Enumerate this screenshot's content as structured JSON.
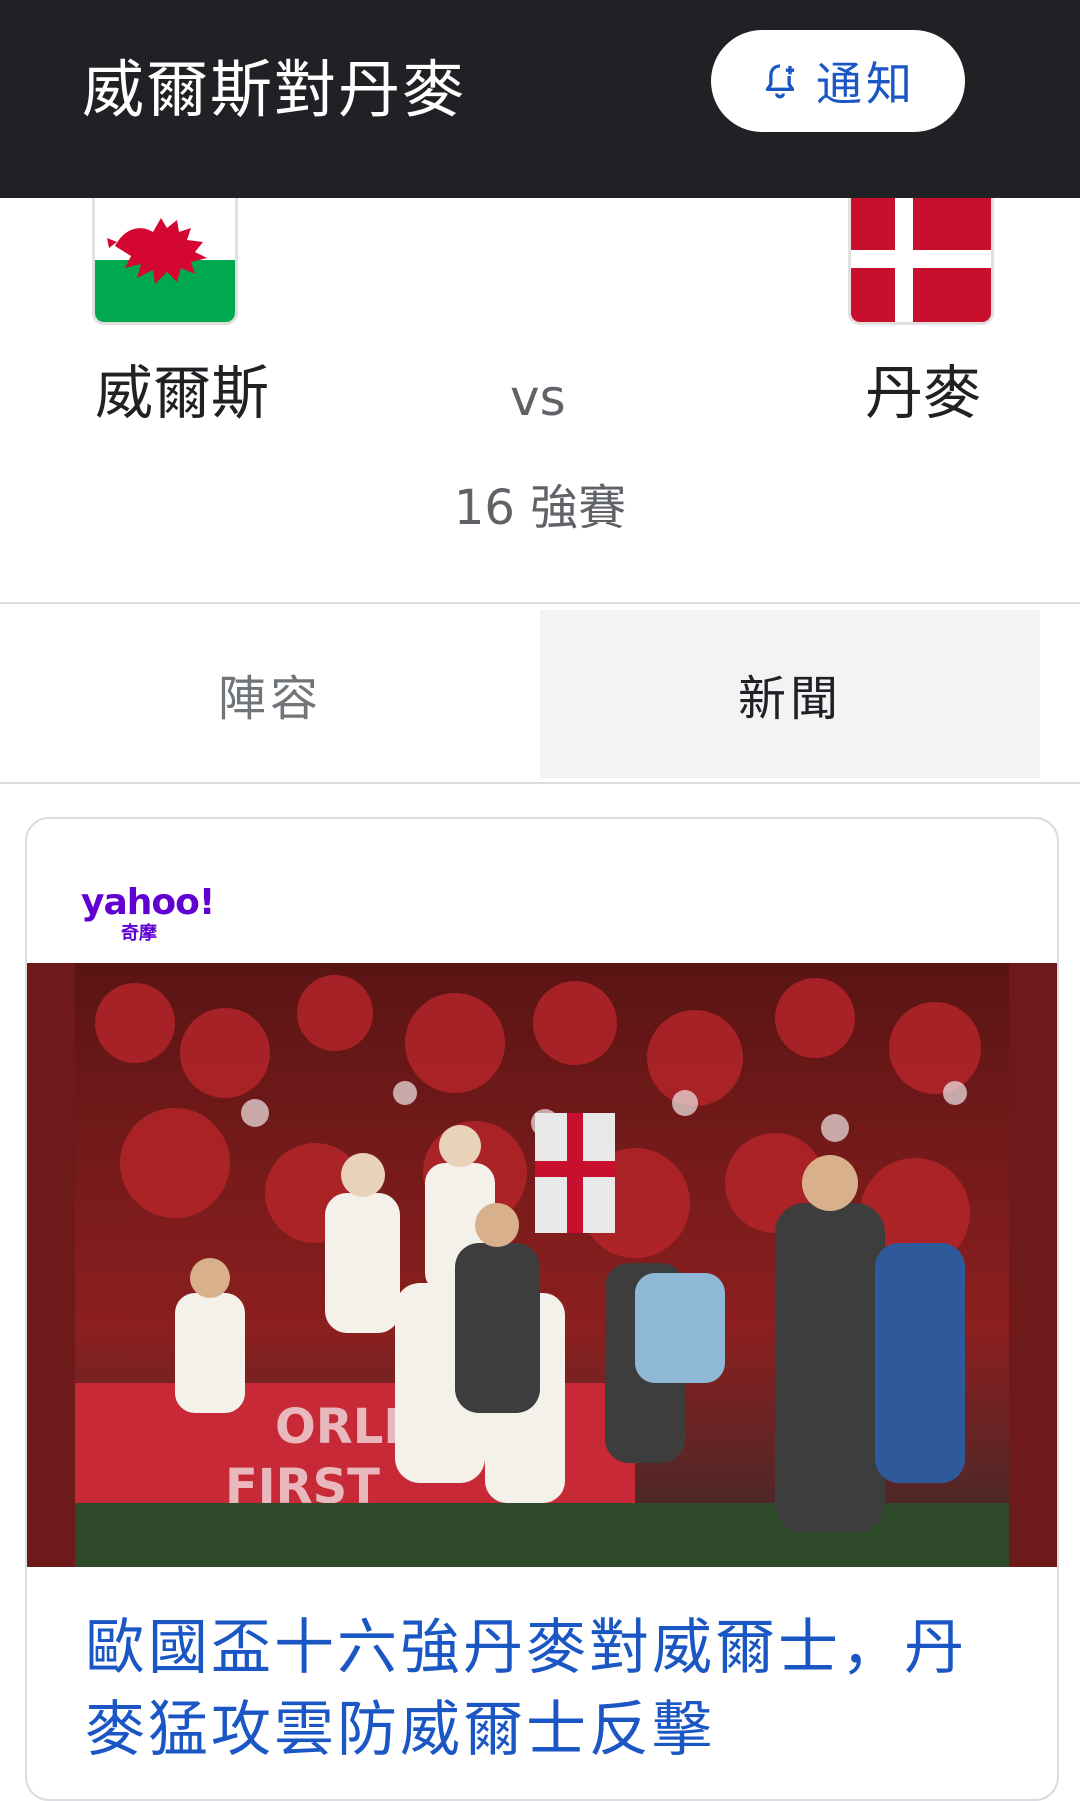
{
  "appbar": {
    "title": "威爾斯對丹麥",
    "notify_label": "通知",
    "notify_icon": "bell-add-icon"
  },
  "match": {
    "home_team": "威爾斯",
    "away_team": "丹麥",
    "vs_label": "vs",
    "round": "16 強賽",
    "home_flag": "wales-flag",
    "away_flag": "denmark-flag"
  },
  "tabs": [
    {
      "label": "陣容",
      "selected": false
    },
    {
      "label": "新聞",
      "selected": true
    }
  ],
  "news": {
    "source_logo_text": "yahoo!",
    "source_logo_sub": "奇摩",
    "image_desc_icon": "news-photo",
    "headline": "歐國盃十六強丹麥對威爾士，丹麥猛攻雲防威爾士反擊"
  },
  "colors": {
    "appbar_bg": "#202124",
    "link_blue": "#1a56c4",
    "yahoo_purple": "#6001d2",
    "tab_selected_bg": "#f1f3f4"
  }
}
